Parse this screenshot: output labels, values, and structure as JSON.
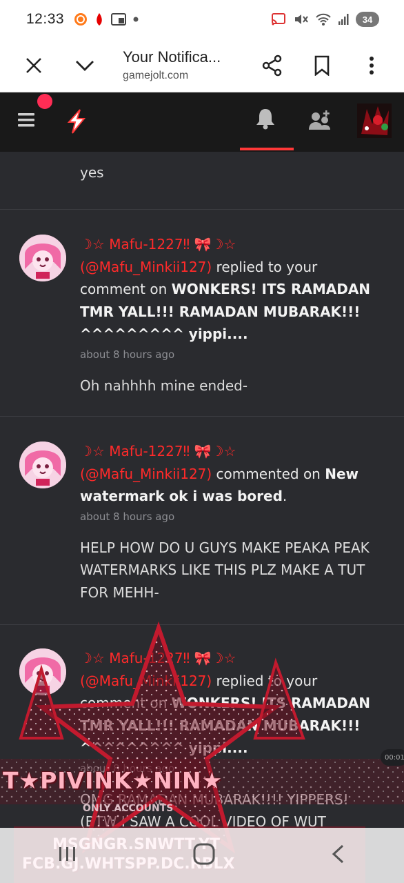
{
  "status_bar": {
    "time": "12:33",
    "battery": "34",
    "colors": {
      "bg": "#ffffff",
      "text": "#222222"
    }
  },
  "browser": {
    "title": "Your Notifica...",
    "domain": "gamejolt.com",
    "icons": [
      "close-icon",
      "chevron-down-icon",
      "share-icon",
      "bookmark-icon",
      "more-vert-icon"
    ]
  },
  "site_nav": {
    "icons": [
      "menu-icon",
      "gamejolt-logo-icon",
      "bell-icon",
      "friends-icon",
      "user-avatar"
    ],
    "active_tab": "notifications",
    "accent": "#ff3838"
  },
  "notifications": [
    {
      "comment": "yes"
    },
    {
      "username": "☽☆ Mafu-1227‼ 🎀☽☆",
      "handle": "(@Mafu_Minkii127)",
      "action": " replied to your comment on ",
      "target": "WONKERS! ITS RAMADAN TMR YALL!!! RAMADAN MUBARAK!!! ^^^^^^^^^ yippi....",
      "target_suffix": "",
      "time": "about 8 hours ago",
      "comment": "Oh nahhhh mine ended-"
    },
    {
      "username": "☽☆ Mafu-1227‼ 🎀☽☆",
      "handle": "(@Mafu_Minkii127)",
      "action": " commented on ",
      "target": "New watermark ok i was bored",
      "target_suffix": ".",
      "time": "about 8 hours ago",
      "comment": "HELP HOW DO U GUYS MAKE PEAKA PEAK WATERMARKS LIKE THIS PLZ MAKE A TUT FOR MEHH-"
    },
    {
      "username": "☽☆ Mafu-1227‼ 🎀☽☆",
      "handle": "(@Mafu_Minkii127)",
      "action": " replied to your comment on ",
      "target": "WONKERS! ITS RAMADAN TMR YALL!!! RAMADAN MUBARAK!!! ^^^^^^^^^ yippi....",
      "target_suffix": "",
      "time": "about 8 hours ago",
      "comment": "OMG RAMADAN MUBARAK!!!! YIPPERS! (BTW I SAW A COOL VIDEO OF WUT"
    }
  ],
  "watermark": {
    "line1": "T★PIVINK★NIN★",
    "line2": "MSGNGR.SNWTT.YT",
    "line3": "FCB.GJ.WHTSPP.DC.RBLX",
    "line4": "ONLY ACCOUNTS"
  },
  "side_timer": "00:01",
  "colors": {
    "page_bg": "#2a2b2f",
    "username_red": "#ff2a2a",
    "meta_gray": "#8d8e93"
  }
}
